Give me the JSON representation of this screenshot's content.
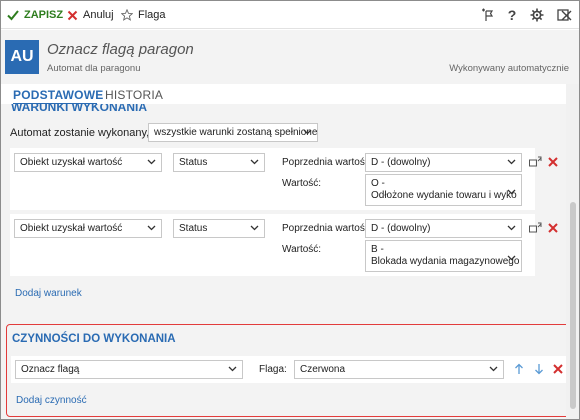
{
  "toolbar": {
    "save_label": "ZAPISZ",
    "cancel_label": "Anuluj",
    "flag_label": "Flaga",
    "right_icons": [
      "add-flag-icon",
      "help-icon",
      "gear-icon",
      "maximize-icon",
      "close-icon"
    ],
    "help_glyph": "?"
  },
  "header": {
    "avatar": "AU",
    "title": "Oznacz flagą paragon",
    "subtitle": "Automat dla paragonu",
    "right_text": "Wykonywany automatycznie"
  },
  "tabs": [
    {
      "label": "PODSTAWOWE",
      "active": true
    },
    {
      "label": "HISTORIA",
      "active": false
    }
  ],
  "hidden_section_title": "WARUNKI WYKONANIA",
  "conditions": {
    "label": "Automat zostanie wykonany, gdy",
    "mode": "wszystkie warunki zostaną spełnione",
    "rows": [
      {
        "type": "Obiekt uzyskał wartość",
        "field": "Status",
        "prev_label": "Poprzednia wartość:",
        "prev_value": "D - (dowolny)",
        "value_label": "Wartość:",
        "value_line1": "O -",
        "value_line2": "Odłożone wydanie towaru i wyko"
      },
      {
        "type": "Obiekt uzyskał wartość",
        "field": "Status",
        "prev_label": "Poprzednia wartość:",
        "prev_value": "D - (dowolny)",
        "value_label": "Wartość:",
        "value_line1": "B -",
        "value_line2": "Blokada wydania magazynowego"
      }
    ],
    "add_link": "Dodaj warunek"
  },
  "actions": {
    "title": "CZYNNOŚCI DO WYKONANIA",
    "row": {
      "action": "Oznacz flagą",
      "flag_label": "Flaga:",
      "flag_value": "Czerwona"
    },
    "add_link": "Dodaj czynność"
  },
  "colors": {
    "accent": "#2a6bb3",
    "save_green": "#2e7d1e",
    "delete_red": "#d32f2f",
    "highlight_border": "#e23b3b"
  }
}
